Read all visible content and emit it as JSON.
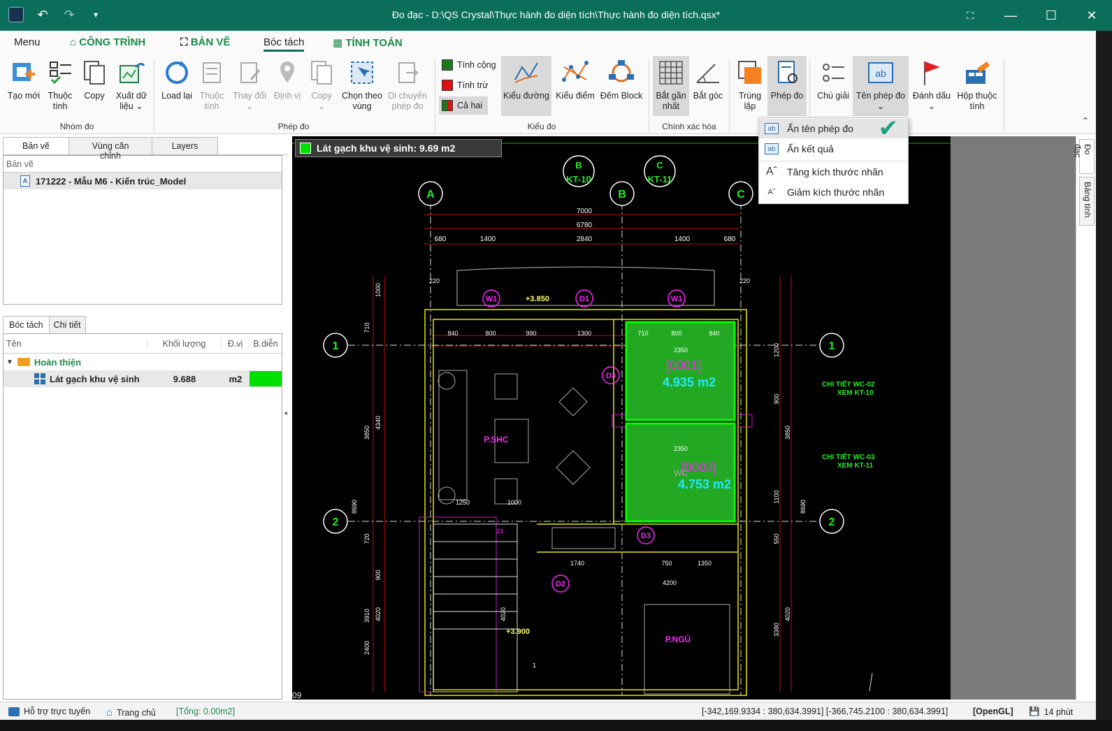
{
  "title": "Đo đạc - D:\\QS Crystal\\Thực hành đo diện tích\\Thực hành đo diện tích.qsx*",
  "menu": {
    "menu": "Menu",
    "cong_trinh": "CÔNG TRÌNH",
    "ban_ve": "BẢN VẼ",
    "boc_tach": "Bóc tách",
    "tinh_toan": "TÍNH TOÁN"
  },
  "ribbon": {
    "tao_moi": "Tạo mới",
    "thuoc_tinh": "Thuộc\ntính",
    "copy": "Copy",
    "xuat_du_lieu": "Xuất dữ\nliệu ⌄",
    "nhom_do": "Nhóm đo",
    "load_lai": "Load lại",
    "thuoc_tinh2": "Thuộc\ntính",
    "thay_doi": "Thay đổi\n⌄",
    "dinh_vi": "Định vị",
    "copy2": "Copy\n⌄",
    "chon_theo_vung": "Chọn theo\nvùng",
    "di_chuyen": "Di chuyển\nphép đo",
    "phep_do_grp": "Phép đo",
    "tinh_cong": "Tính cộng",
    "tinh_tru": "Tính trừ",
    "ca_hai": "Cả hai",
    "kieu_duong": "Kiểu đường",
    "kieu_diem": "Kiểu điểm",
    "dem_block": "Đếm Block",
    "kieu_do_grp": "Kiểu đo",
    "bat_gan_nhat": "Bắt gần\nnhất",
    "bat_goc": "Bắt góc",
    "chinh_xac_hoa": "Chính xác hóa",
    "trung_lap": "Trùng\nlặp",
    "phep_do": "Phép đo",
    "chu_giai": "Chú giải",
    "ten_phep_do": "Tên phép đo\n⌄",
    "danh_dau": "Đánh dấu\n⌄",
    "hop_thuoc_tinh": "Hộp thuộc\ntính"
  },
  "left": {
    "tabs": [
      "Bản vẽ",
      "Vùng căn chỉnh",
      "Layers"
    ],
    "section_label": "Bản vẽ",
    "drawing_item": "171222 - Mẫu M6 - Kiến trúc_Model",
    "tabs2": [
      "Bóc tách",
      "Chi tiết"
    ],
    "cols": [
      "Tên",
      "Khối lượng",
      "Đ.vị",
      "B.diễn"
    ],
    "group": "Hoàn thiện",
    "row": {
      "name": "Lát gạch khu vệ sinh",
      "qty": "9.688",
      "unit": "m2"
    }
  },
  "canvas": {
    "badge": "Lát gạch khu vệ sinh: 9.69 m2",
    "area1_id": "[0001]",
    "area1": "4.935 m2",
    "area2_id": "[0002]",
    "area2": "4.753 m2",
    "room1": "P.SHC",
    "room2": "P.NGỦ",
    "grid_letters": [
      "A",
      "B",
      "C"
    ],
    "grid_tags": [
      "B",
      "KT-10",
      "C",
      "KT-11"
    ],
    "grid_nums": [
      "1",
      "2"
    ],
    "dims_top": [
      "7000",
      "6780",
      "680",
      "1400",
      "2840",
      "1400",
      "680"
    ],
    "note1a": "CHI TIẾT WC-02",
    "note1b": "XEM KT-10",
    "note2a": "CHI TIẾT WC-03",
    "note2b": "XEM KT-11",
    "level1": "+3.850",
    "level2": "+3.900",
    "tags": [
      "W1",
      "D1",
      "W1",
      "D3",
      "D3",
      "D2"
    ],
    "dims_mid": [
      "840",
      "800",
      "990",
      "1300",
      "710",
      "800",
      "840",
      "2350",
      "2350",
      "1250",
      "1000",
      "1740",
      "1740",
      "750",
      "1350",
      "4200"
    ],
    "dims_left": [
      "1000",
      "710",
      "3850",
      "4340",
      "8690",
      "4020",
      "3910",
      "900",
      "720",
      "2400",
      "4020"
    ],
    "dims_right": [
      "1200",
      "900",
      "3850",
      "1100",
      "8690",
      "550",
      "4020",
      "3380"
    ],
    "misc": [
      "WC",
      "09",
      "220",
      "220",
      "23",
      "1"
    ]
  },
  "sidebar": {
    "tab1": "Đo đạc",
    "tab2": "Bảng tính"
  },
  "status": {
    "help": "Hỗ trợ trực tuyến",
    "home": "Trang chủ",
    "total": "[Tổng: 0.00m2]",
    "coords": "[-342,169.9334 : 380,634.3991] [-366,745.2100 : 380,634.3991]",
    "renderer": "[OpenGL]",
    "time": "14 phút"
  },
  "dropdown": {
    "items": [
      "Ẩn tên phép đo",
      "Ẩn kết quả",
      "Tăng kích thước nhãn",
      "Giảm kích thước nhãn"
    ]
  },
  "colors": {
    "titlebar": "#0b6e5b",
    "accent_green": "#1a8a4a",
    "cad_bg": "#000000",
    "area_fill": "#22a822"
  }
}
